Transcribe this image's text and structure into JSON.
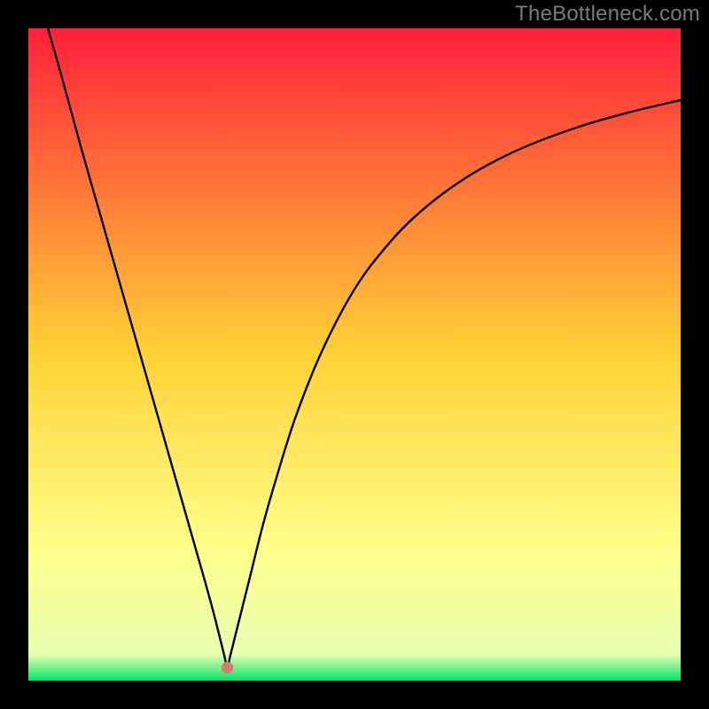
{
  "attribution": "TheBottleneck.com",
  "chart_data": {
    "type": "line",
    "title": "",
    "xlabel": "",
    "ylabel": "",
    "xlim": [
      0,
      100
    ],
    "ylim": [
      0,
      100
    ],
    "grid": false,
    "legend": false,
    "background_gradient": [
      {
        "stop": 0.0,
        "color": "#ff1f3a"
      },
      {
        "stop": 0.5,
        "color": "#ffd236"
      },
      {
        "stop": 0.8,
        "color": "#ffff8a"
      },
      {
        "stop": 0.96,
        "color": "#e7ffb0"
      },
      {
        "stop": 1.0,
        "color": "#00e66a"
      }
    ],
    "marker": {
      "x": 30.5,
      "y": 2,
      "color": "#d77a6f",
      "radius_pct": 0.9
    },
    "series": [
      {
        "name": "curve",
        "x": [
          3,
          5,
          8,
          11,
          14,
          17,
          20,
          23,
          25,
          27,
          28.5,
          30,
          30.5,
          31,
          32.5,
          34,
          36,
          38,
          41,
          45,
          50,
          55,
          60,
          66,
          72,
          78,
          85,
          92,
          100
        ],
        "y": [
          100,
          93,
          82,
          71.5,
          61,
          50.5,
          40,
          29.5,
          22.5,
          15.5,
          10,
          4,
          2,
          4,
          10,
          16,
          24,
          31,
          40.5,
          50.5,
          60,
          66.7,
          71.8,
          76.4,
          79.9,
          82.6,
          85.1,
          87.1,
          89
        ]
      }
    ]
  }
}
